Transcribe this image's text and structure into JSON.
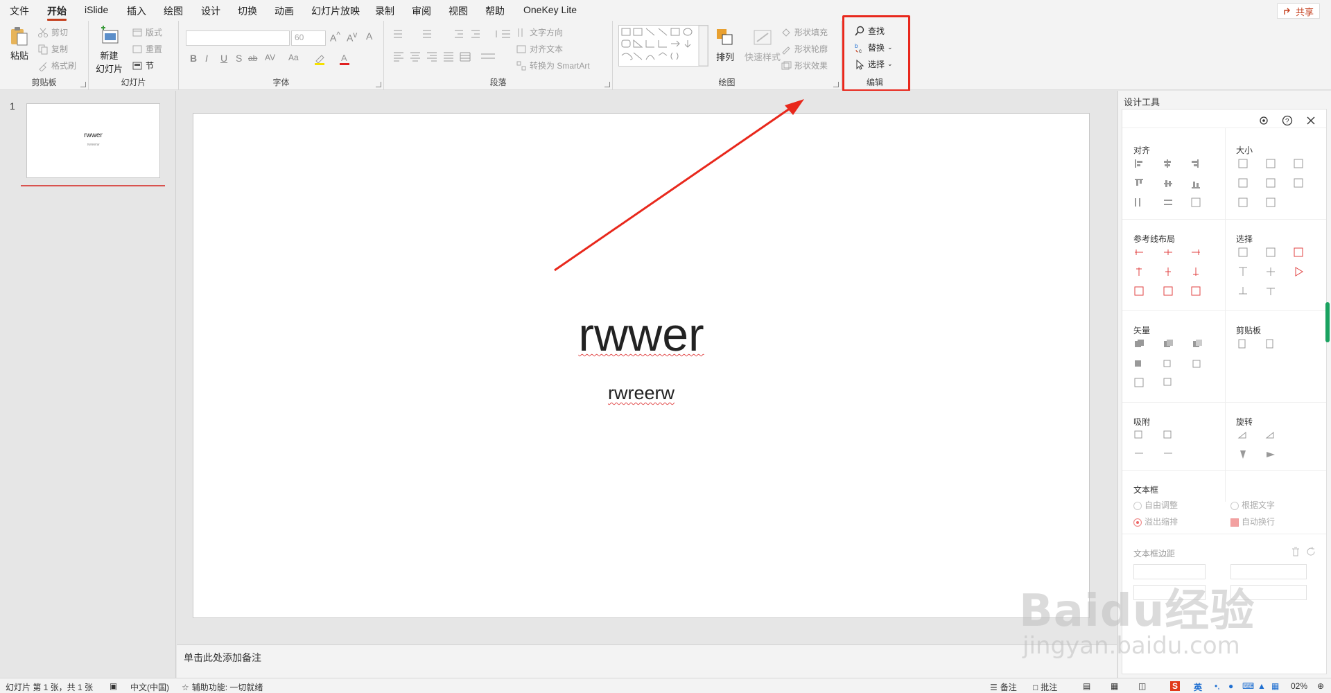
{
  "tabs": [
    "文件",
    "开始",
    "iSlide",
    "插入",
    "绘图",
    "设计",
    "切换",
    "动画",
    "幻灯片放映",
    "录制",
    "审阅",
    "视图",
    "帮助",
    "OneKey Lite"
  ],
  "active_tab": "开始",
  "share_label": "共享",
  "ribbon": {
    "clipboard": {
      "paste": "粘贴",
      "cut": "剪切",
      "copy": "复制",
      "format_painter": "格式刷",
      "label": "剪贴板"
    },
    "slides": {
      "new_slide": "新建",
      "new_slide_2": "幻灯片",
      "layout": "版式",
      "reset": "重置",
      "section": "节",
      "label": "幻灯片"
    },
    "font": {
      "font_size": "60",
      "label": "字体",
      "bold": "B",
      "italic": "I",
      "underline": "U",
      "shadow": "S",
      "strike": "ab",
      "spacing": "AV",
      "case": "Aa"
    },
    "paragraph": {
      "text_direction": "文字方向",
      "align_text": "对齐文本",
      "smartart": "转换为 SmartArt",
      "label": "段落"
    },
    "drawing": {
      "arrange": "排列",
      "quick_styles": "快速样式",
      "fill": "形状填充",
      "outline": "形状轮廓",
      "effects": "形状效果",
      "label": "绘图"
    },
    "editing": {
      "find": "查找",
      "replace": "替换",
      "select": "选择",
      "label": "编辑"
    }
  },
  "thumbnail": {
    "number": "1",
    "title": "rwwer",
    "subtitle": "rwreerw"
  },
  "slide": {
    "title": "rwwer",
    "subtitle": "rwreerw"
  },
  "notes_placeholder": "单击此处添加备注",
  "design_panel": {
    "title": "设计工具",
    "sections": {
      "align": "对齐",
      "size": "大小",
      "guides": "参考线布局",
      "select": "选择",
      "vector": "矢量",
      "clipboard": "剪贴板",
      "snap": "吸附",
      "rotate": "旋转",
      "textbox": "文本框",
      "margin": "文本框边距"
    },
    "textbox_options": {
      "free": "自由调整",
      "fit_text": "根据文字",
      "overflow": "溢出缩排",
      "wrap": "自动换行"
    }
  },
  "status": {
    "slide_info": "幻灯片 第 1 张，共 1 张",
    "language": "中文(中国)",
    "accessibility": "辅助功能: 一切就绪",
    "notes": "备注",
    "comments": "批注",
    "zoom": "02%",
    "ime": "英"
  },
  "watermark": {
    "line1": "Baidu经验",
    "line2": "jingyan.baidu.com"
  },
  "colors": {
    "accent": "#c43e1c",
    "highlight": "#e8281c",
    "scroll": "#1aa260"
  }
}
